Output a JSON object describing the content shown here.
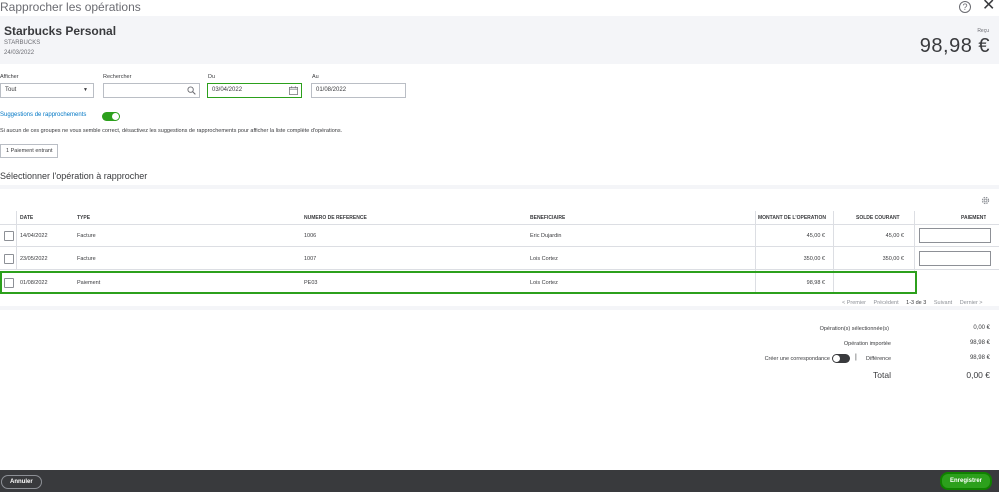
{
  "window": {
    "title": "Rapprocher les opérations",
    "help_icon": "help-circle-icon",
    "close_icon": "close-icon",
    "help_glyph": "?",
    "close_glyph": "✕"
  },
  "transaction": {
    "merchant": "Starbucks Personal",
    "subtitle": "STARBUCKS",
    "date": "24/03/2022",
    "amount_label": "Reçu",
    "amount": "98,98 €"
  },
  "filters": {
    "show_label": "Afficher",
    "show_value": "Tout",
    "search_label": "Rechercher",
    "search_value": "",
    "from_label": "Du",
    "from_value": "03/04/2022",
    "to_label": "Au",
    "to_value": "01/08/2022"
  },
  "suggestions": {
    "label": "Suggestions de rapprochements",
    "enabled": true,
    "info": "Si aucun de ces groupes ne vous semble correct, désactivez les suggestions de rapprochements pour afficher la liste complète d'opérations.",
    "chip": "1 Paiement entrant"
  },
  "section_title": "Sélectionner l'opération à rapprocher",
  "table": {
    "columns": [
      "DATE",
      "TYPE",
      "NUMÉRO DE RÉFÉRENCE",
      "BÉNÉFICIAIRE",
      "MONTANT DE L'OPÉRATION",
      "SOLDE COURANT",
      "PAIEMENT"
    ],
    "rows": [
      {
        "date": "14/04/2022",
        "type": "Facture",
        "ref": "1006",
        "payee": "Eric Dujardin",
        "amount": "45,00 €",
        "balance": "45,00 €",
        "has_payment_input": true
      },
      {
        "date": "23/05/2022",
        "type": "Facture",
        "ref": "1007",
        "payee": "Lois Cortez",
        "amount": "350,00 €",
        "balance": "350,00 €",
        "has_payment_input": true
      },
      {
        "date": "01/08/2022",
        "type": "Paiement",
        "ref": "PE03",
        "payee": "Lois Cortez",
        "amount": "98,98 €",
        "balance": "",
        "has_payment_input": false,
        "highlighted": true
      }
    ]
  },
  "pager": {
    "first": "< Premier",
    "prev": "Précédent",
    "range": "1-3 de 3",
    "next": "Suivant",
    "last": "Dernier >"
  },
  "summary": {
    "selected_label": "Opération(s) sélectionnée(s)",
    "selected_value": "0,00 €",
    "imported_label": "Opération importée",
    "imported_value": "98,98 €",
    "create_match_label": "Créer une correspondance",
    "difference_label": "Différence",
    "difference_value": "98,98 €",
    "total_label": "Total",
    "total_value": "0,00 €"
  },
  "footer": {
    "cancel_label": "Annuler",
    "save_label": "Enregistrer"
  },
  "colors": {
    "accent_green": "#2ca01c",
    "link_blue": "#0077c5",
    "footer_dark": "#393a3d"
  }
}
